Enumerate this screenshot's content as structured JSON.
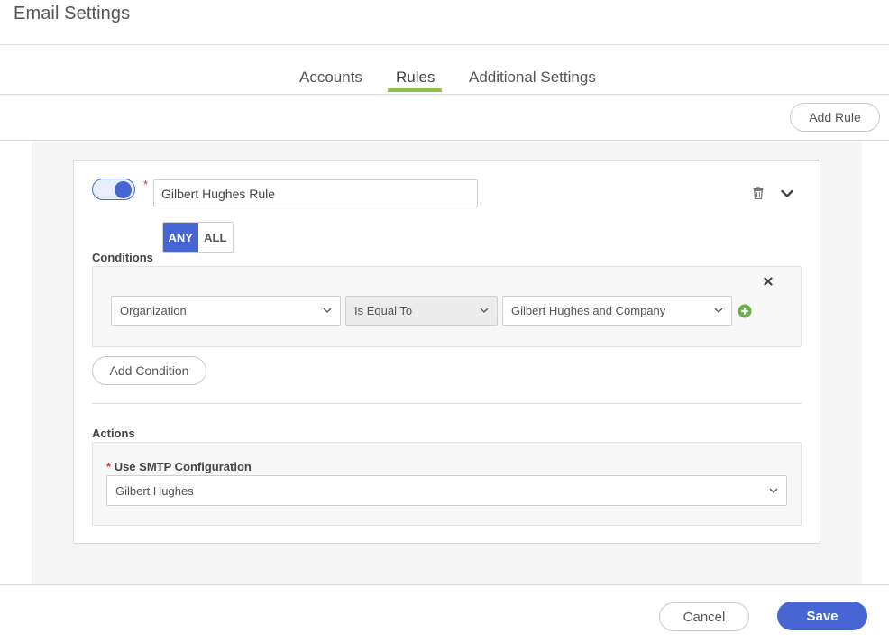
{
  "page": {
    "title": "Email Settings"
  },
  "tabs": [
    {
      "label": "Accounts"
    },
    {
      "label": "Rules"
    },
    {
      "label": "Additional Settings"
    }
  ],
  "toolbar": {
    "add_rule_label": "Add Rule"
  },
  "rule": {
    "enabled": true,
    "name_value": "Gilbert Hughes Rule",
    "required_marker": "*",
    "match_mode": {
      "any_label": "ANY",
      "all_label": "ALL",
      "selected": "ANY"
    },
    "conditions_label": "Conditions",
    "condition": {
      "field": "Organization",
      "operator": "Is Equal To",
      "value": "Gilbert Hughes and Company"
    },
    "add_condition_label": "Add Condition",
    "actions_label": "Actions",
    "smtp": {
      "required_marker": "*",
      "label": "Use SMTP Configuration",
      "value": "Gilbert Hughes"
    }
  },
  "footer": {
    "cancel_label": "Cancel",
    "save_label": "Save"
  },
  "icons": {
    "trash": "trash-icon",
    "collapse": "chevron-down-icon",
    "remove_condition": "close-icon",
    "add_condition_row": "plus-circle-icon"
  },
  "colors": {
    "accent": "#4766d3",
    "tab_active": "#8bc34a",
    "add_green": "#6ab04c",
    "required": "#d03030"
  }
}
